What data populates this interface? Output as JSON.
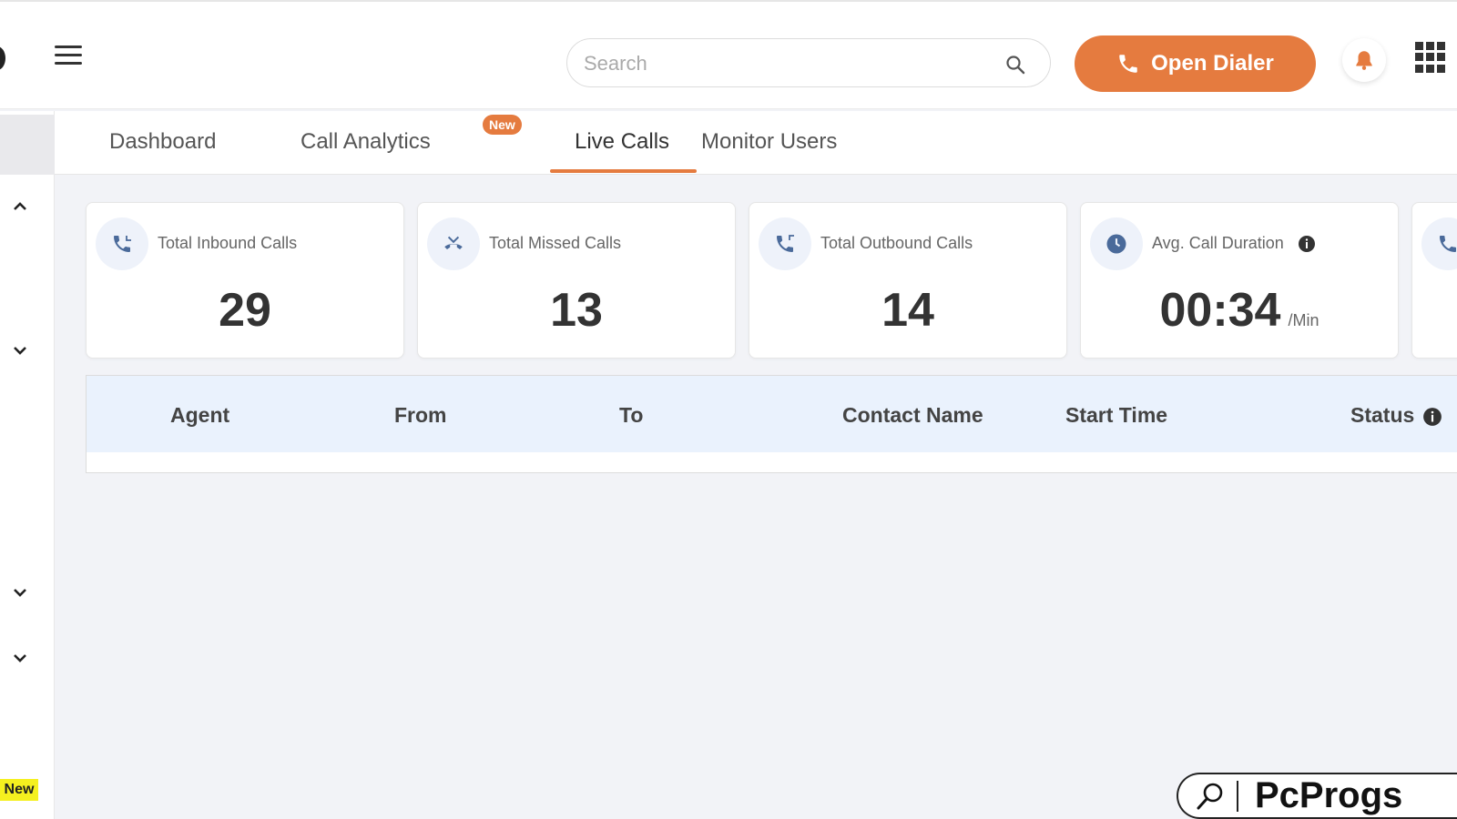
{
  "header": {
    "menu_icon": "hamburger-icon",
    "search": {
      "placeholder": "Search",
      "value": ""
    },
    "dialer_label": "Open Dialer",
    "notification_icon": "bell-icon",
    "apps_icon": "grid-apps-icon"
  },
  "colors": {
    "accent": "#e57b3f",
    "header_row": "#eaf2fd",
    "new_tag": "#f5f01f"
  },
  "sidebar": {
    "new_tag": "New"
  },
  "tabs": [
    {
      "label": "Dashboard",
      "active": false
    },
    {
      "label": "Call Analytics",
      "active": false,
      "badge": "New"
    },
    {
      "label": "Live Calls",
      "active": true
    },
    {
      "label": "Monitor Users",
      "active": false
    }
  ],
  "stats": [
    {
      "label": "Total Inbound Calls",
      "value": "29",
      "icon": "inbound-call-icon"
    },
    {
      "label": "Total Missed Calls",
      "value": "13",
      "icon": "missed-call-icon"
    },
    {
      "label": "Total Outbound Calls",
      "value": "14",
      "icon": "outbound-call-icon"
    },
    {
      "label": "Avg. Call Duration",
      "value": "00:34",
      "unit": "/Min",
      "icon": "clock-icon"
    }
  ],
  "table": {
    "columns": [
      "Agent",
      "From",
      "To",
      "Contact Name",
      "Start Time",
      "Status"
    ],
    "rows": []
  },
  "watermark": "PcProgs"
}
